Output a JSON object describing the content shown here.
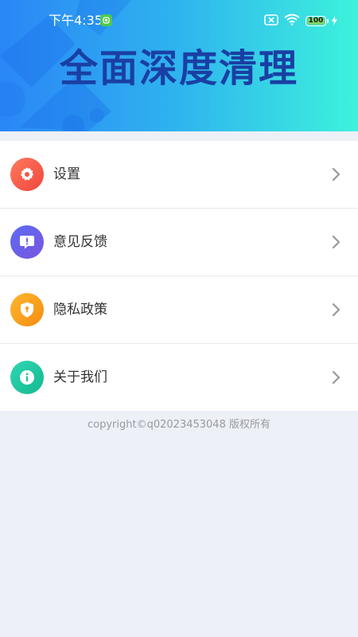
{
  "status_bar": {
    "time": "下午4:35",
    "battery": "100",
    "icons": [
      "app-notification-icon",
      "sim-off-icon",
      "wifi-icon",
      "battery-icon",
      "charging-icon"
    ]
  },
  "banner": {
    "title": "全面深度清理",
    "title_color": "#1a3fa4",
    "gradient": [
      "#2a86f6",
      "#3df2dc"
    ]
  },
  "menu": {
    "items": [
      {
        "label": "设置",
        "icon": "gear-icon",
        "color": "#f4574a"
      },
      {
        "label": "意见反馈",
        "icon": "feedback-icon",
        "color": "#6c63e8"
      },
      {
        "label": "隐私政策",
        "icon": "shield-icon",
        "color": "#f7a21c"
      },
      {
        "label": "关于我们",
        "icon": "info-icon",
        "color": "#22c9a2"
      }
    ]
  },
  "footer": {
    "copyright": "copyright©q02023453048 版权所有"
  }
}
